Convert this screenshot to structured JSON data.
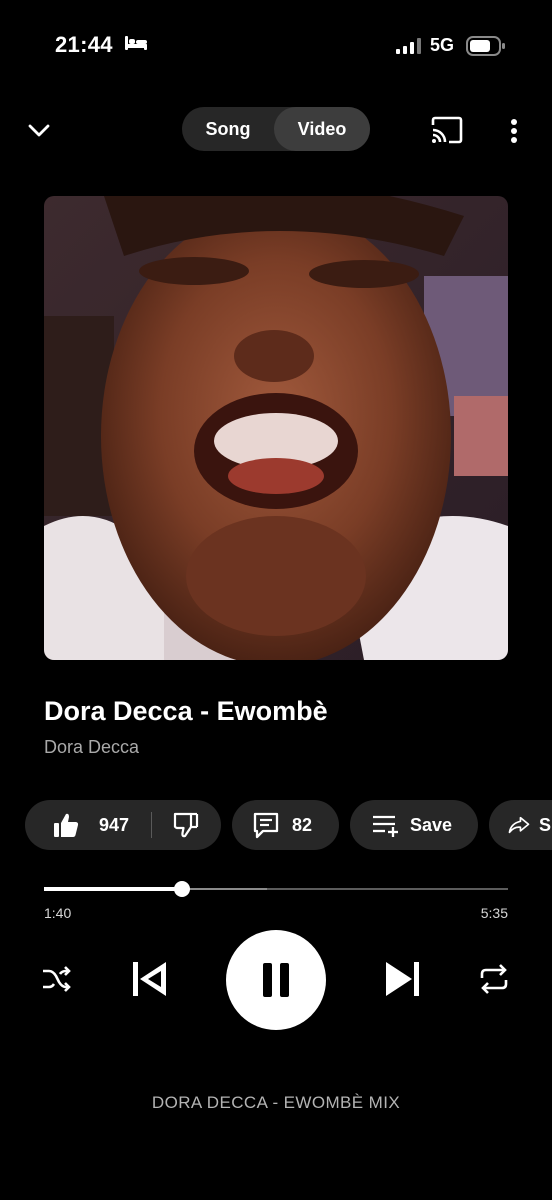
{
  "status_bar": {
    "time": "21:44",
    "network": "5G"
  },
  "top_bar": {
    "toggle": [
      {
        "label": "Song"
      },
      {
        "label": "Video"
      }
    ],
    "active_toggle": "Video"
  },
  "track": {
    "title": "Dora Decca - Ewombè",
    "artist": "Dora Decca"
  },
  "actions": {
    "likes": "947",
    "comments": "82",
    "save_label": "Save",
    "share_label": "Share"
  },
  "progress": {
    "elapsed": "1:40",
    "duration": "5:35",
    "played_fraction": 0.298,
    "buffered_fraction": 0.48
  },
  "playlist": {
    "label": "DORA DECCA - EWOMBÈ MIX"
  },
  "colors": {
    "background": "#000000",
    "chip": "#272727",
    "toggle_active": "#3d3d3d",
    "secondary_text": "#a9a9a9"
  },
  "icons": [
    "bed-icon",
    "signal-icon",
    "battery-icon",
    "chevron-down-icon",
    "cast-icon",
    "more-vert-icon",
    "thumbs-up-icon",
    "thumbs-down-icon",
    "comment-icon",
    "playlist-add-icon",
    "share-icon",
    "shuffle-icon",
    "skip-previous-icon",
    "pause-icon",
    "skip-next-icon",
    "repeat-icon"
  ]
}
